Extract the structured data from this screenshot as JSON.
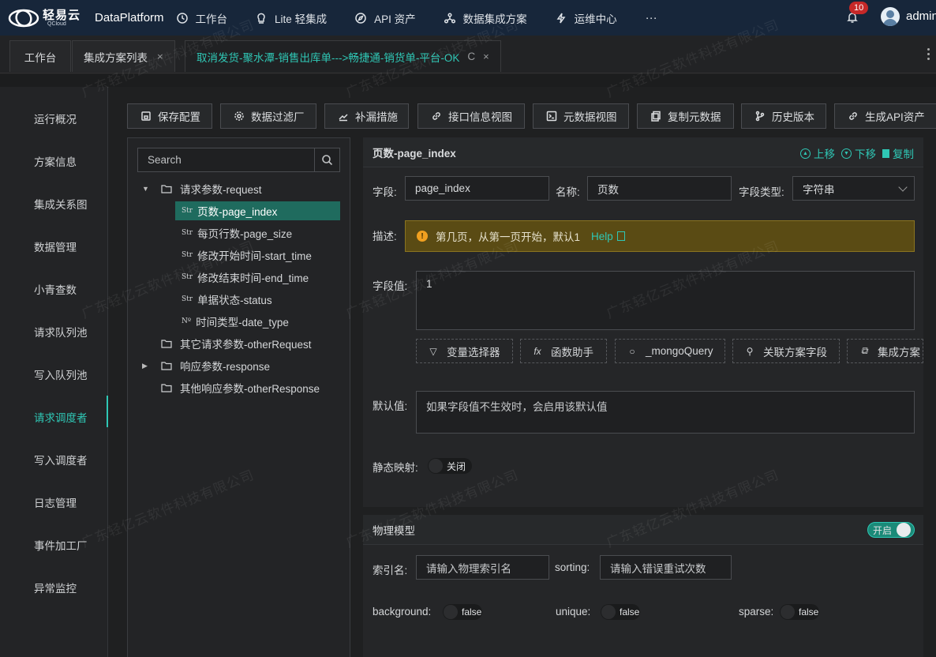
{
  "topnav": {
    "logo_text": "轻易云",
    "logo_sub": "QCloud",
    "brand": "DataPlatform",
    "items": [
      {
        "label": "工作台",
        "icon": "clock-icon"
      },
      {
        "label": "Lite 轻集成",
        "icon": "bulb-icon"
      },
      {
        "label": "API 资产",
        "icon": "compass-icon"
      },
      {
        "label": "数据集成方案",
        "icon": "network-icon"
      },
      {
        "label": "运维中心",
        "icon": "bolt-icon"
      }
    ],
    "more": "···",
    "notifications": "10",
    "user": "admin"
  },
  "tabs": [
    {
      "label": "工作台"
    },
    {
      "label": "集成方案列表",
      "close": "×"
    },
    {
      "label": "取消发货-聚水潭-销售出库单--->畅捷通-销货单-平台-OK",
      "close": "×",
      "refresh": "C"
    }
  ],
  "sidebar": {
    "items": [
      "运行概况",
      "方案信息",
      "集成关系图",
      "数据管理",
      "小青查数",
      "请求队列池",
      "写入队列池",
      "请求调度者",
      "写入调度者",
      "日志管理",
      "事件加工厂",
      "异常监控"
    ],
    "active": "请求调度者"
  },
  "toolbar": {
    "buttons": [
      "保存配置",
      "数据过滤厂",
      "补漏措施",
      "接口信息视图",
      "元数据视图",
      "复制元数据",
      "历史版本",
      "生成API资产"
    ]
  },
  "tree": {
    "search_placeholder": "Search",
    "nodes": [
      {
        "label": "请求参数-request"
      },
      {
        "label": "页数-page_index",
        "type": "Str"
      },
      {
        "label": "每页行数-page_size",
        "type": "Str"
      },
      {
        "label": "修改开始时间-start_time",
        "type": "Str"
      },
      {
        "label": "修改结束时间-end_time",
        "type": "Str"
      },
      {
        "label": "单据状态-status",
        "type": "Str"
      },
      {
        "label": "时间类型-date_type",
        "type": "Nº"
      },
      {
        "label": "其它请求参数-otherRequest"
      },
      {
        "label": "响应参数-response"
      },
      {
        "label": "其他响应参数-otherResponse"
      }
    ]
  },
  "detail": {
    "title": "页数-page_index",
    "up": "上移",
    "down": "下移",
    "copy": "复制",
    "field_label": "字段:",
    "field_value": "page_index",
    "name_label": "名称:",
    "name_value": "页数",
    "type_label": "字段类型:",
    "type_value": "字符串",
    "desc_label": "描述:",
    "desc_text": "第几页，从第一页开始，默认1",
    "help": "Help",
    "value_label": "字段值:",
    "value": "1",
    "helpers": [
      "变量选择器",
      "函数助手",
      "_mongoQuery",
      "关联方案字段",
      "集成方案"
    ],
    "default_label": "默认值:",
    "default_placeholder": "如果字段值不生效时，会启用该默认值",
    "static_label": "静态映射:",
    "static_state": "关闭"
  },
  "physical": {
    "title": "物理模型",
    "toggle": "开启",
    "index_label": "索引名:",
    "index_placeholder": "请输入物理索引名",
    "sorting_label": "sorting:",
    "sorting_placeholder": "请输入错误重试次数",
    "background_label": "background:",
    "background_value": "false",
    "unique_label": "unique:",
    "unique_value": "false",
    "sparse_label": "sparse:",
    "sparse_value": "false"
  },
  "watermark": "广东轻亿云软件科技有限公司"
}
